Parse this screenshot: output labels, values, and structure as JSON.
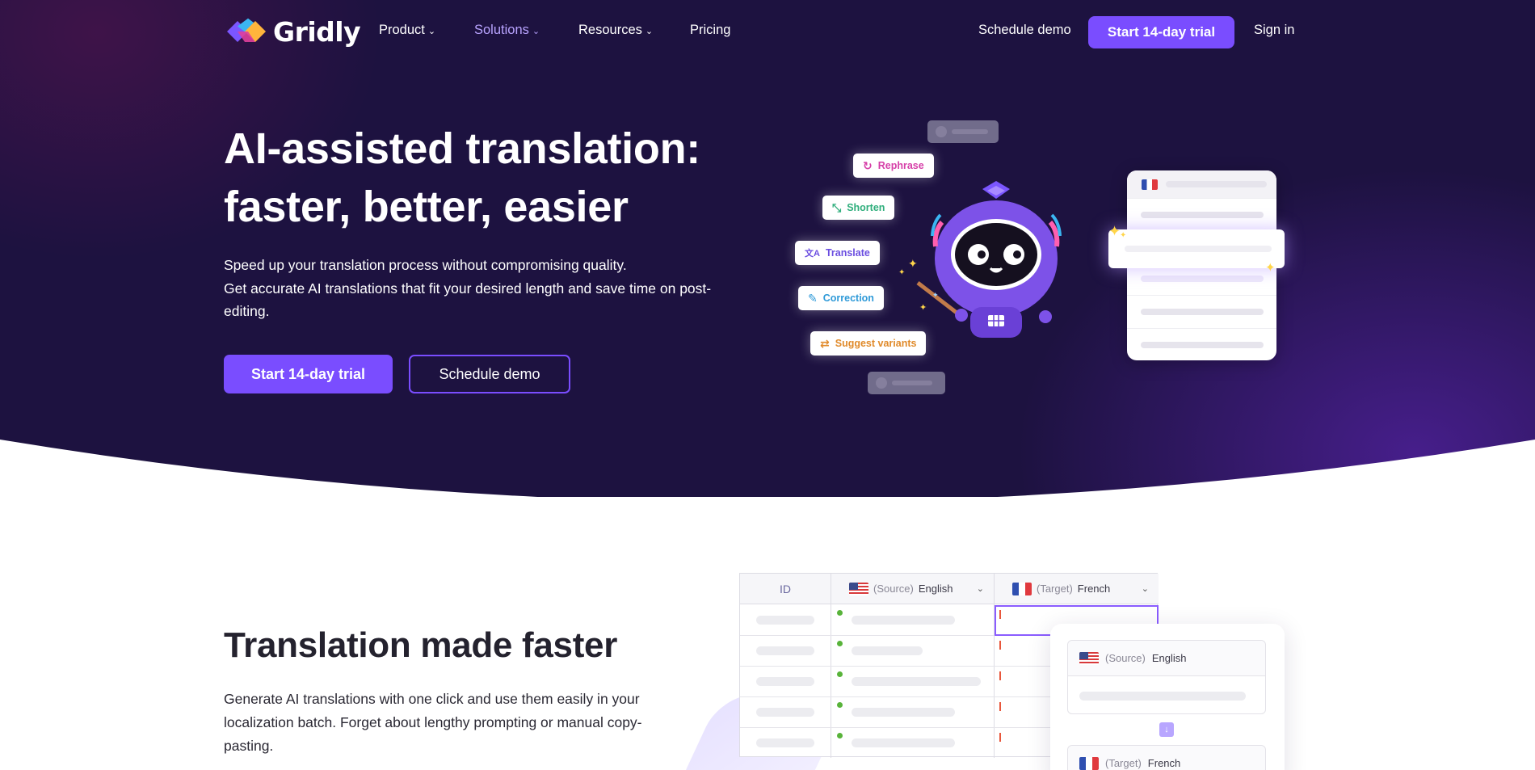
{
  "nav": {
    "logo_text": "Gridly",
    "items": [
      {
        "label": "Product",
        "has_dropdown": true,
        "active": false
      },
      {
        "label": "Solutions",
        "has_dropdown": true,
        "active": true
      },
      {
        "label": "Resources",
        "has_dropdown": true,
        "active": false
      },
      {
        "label": "Pricing",
        "has_dropdown": false,
        "active": false
      }
    ],
    "schedule_demo": "Schedule demo",
    "start_trial": "Start 14-day trial",
    "sign_in": "Sign in",
    "chevron_glyph": "⌄"
  },
  "hero": {
    "title_line1": "AI-assisted translation:",
    "title_line2": "faster, better, easier",
    "subtitle_line1": "Speed up your translation process without compromising quality.",
    "subtitle_line2": "Get accurate AI translations that fit your desired length and save time on post-editing.",
    "primary_cta": "Start 14-day trial",
    "secondary_cta": "Schedule demo",
    "ai_actions": [
      {
        "label": "Rephrase",
        "icon": "refresh-icon",
        "glyph": "↻",
        "color": "#d63fa8"
      },
      {
        "label": "Shorten",
        "icon": "shorten-icon",
        "glyph": "⤡",
        "color": "#2fae7c"
      },
      {
        "label": "Translate",
        "icon": "translate-icon",
        "glyph": "文A",
        "color": "#6a4de0"
      },
      {
        "label": "Correction",
        "icon": "correction-icon",
        "glyph": "✎",
        "color": "#2f9ad8"
      },
      {
        "label": "Suggest variants",
        "icon": "variants-icon",
        "glyph": "⇄",
        "color": "#e08a2a"
      }
    ]
  },
  "section2": {
    "title": "Translation made faster",
    "text": "Generate AI translations with one click and use them easily in your localization batch. Forget about lengthy prompting or manual copy-pasting.",
    "grid": {
      "col_id": "ID",
      "source_prefix": "(Source)",
      "source_lang": "English",
      "target_prefix": "(Target)",
      "target_lang": "French",
      "chevron": "⌄"
    },
    "panel": {
      "source_prefix": "(Source)",
      "source_lang": "English",
      "target_prefix": "(Target)",
      "target_lang": "French",
      "arrow_glyph": "↓"
    }
  },
  "colors": {
    "hero_bg": "#1d1240",
    "accent": "#7a4dff",
    "active_nav": "#b9a4ff"
  }
}
